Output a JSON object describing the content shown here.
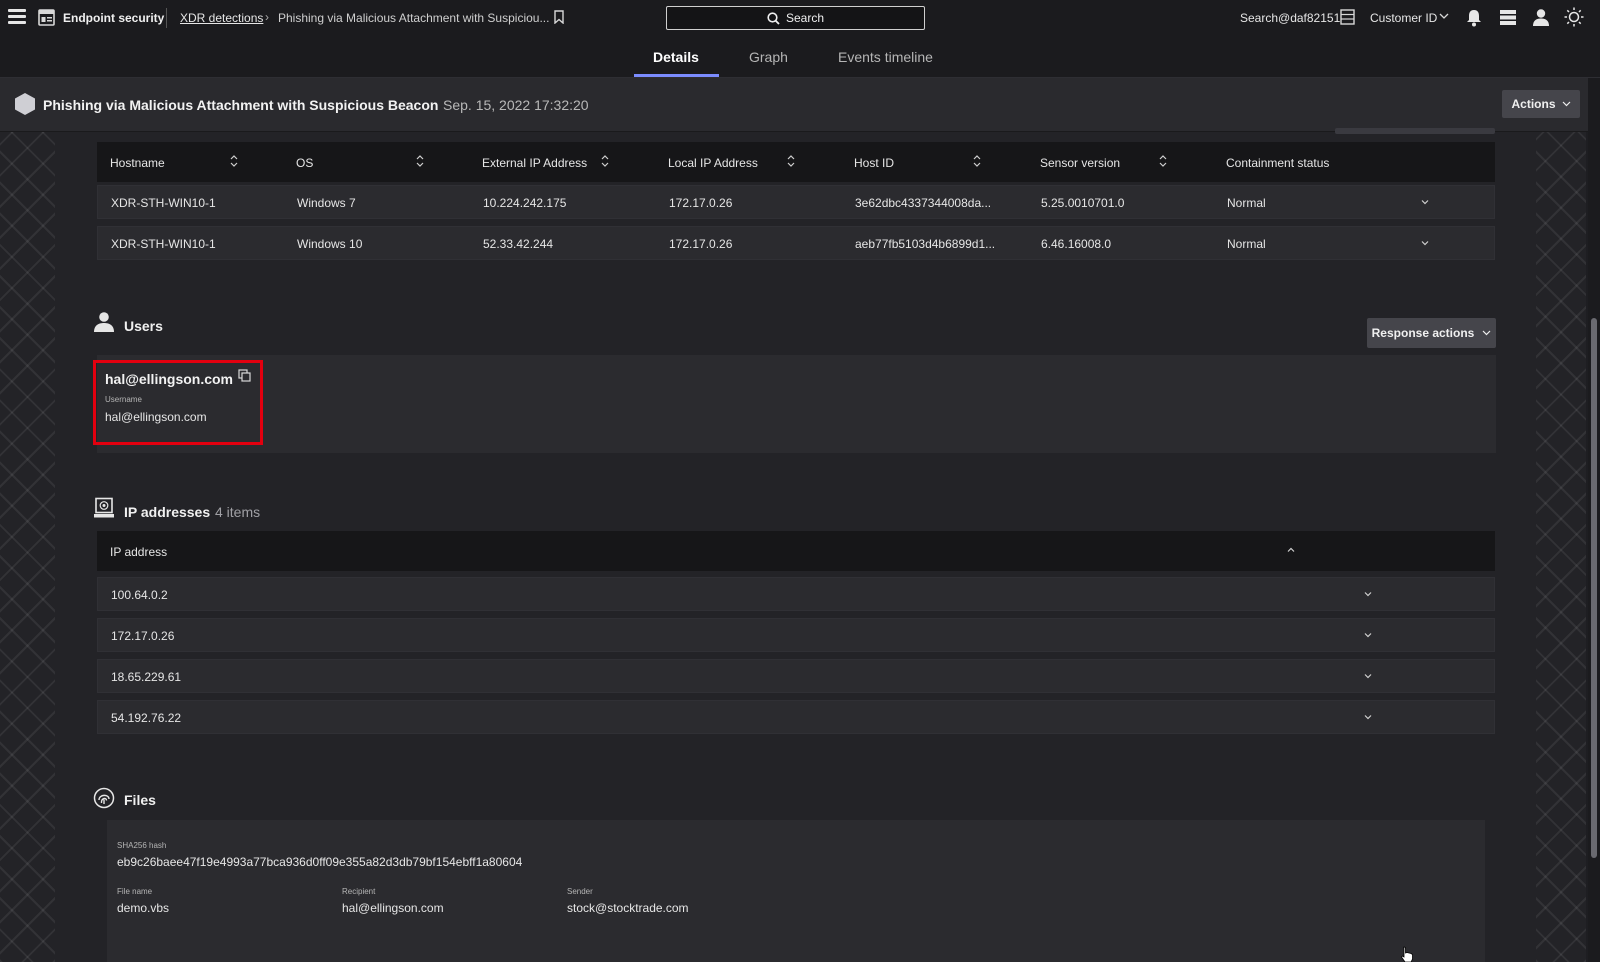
{
  "topbar": {
    "app_title": "Endpoint security",
    "breadcrumb_1": "XDR detections",
    "breadcrumb_2": "Phishing via Malicious Attachment with Suspiciou...",
    "search_label": "Search",
    "user_label": "Search@daf82151",
    "customer_id_label": "Customer ID"
  },
  "tabs": [
    {
      "label": "Details",
      "active": true
    },
    {
      "label": "Graph",
      "active": false
    },
    {
      "label": "Events timeline",
      "active": false
    }
  ],
  "detection": {
    "title": "Phishing via Malicious Attachment with Suspicious Beacon",
    "timestamp": "Sep. 15, 2022 17:32:20",
    "actions_label": "Actions"
  },
  "hosts": {
    "columns": [
      "Hostname",
      "OS",
      "External IP Address",
      "Local IP Address",
      "Host ID",
      "Sensor version",
      "Containment status"
    ],
    "rows": [
      [
        "XDR-STH-WIN10-1",
        "Windows 7",
        "10.224.242.175",
        "172.17.0.26",
        "3e62dbc4337344008da...",
        "5.25.0010701.0",
        "Normal"
      ],
      [
        "XDR-STH-WIN10-1",
        "Windows 10",
        "52.33.42.244",
        "172.17.0.26",
        "aeb77fb5103d4b6899d1...",
        "6.46.16008.0",
        "Normal"
      ]
    ]
  },
  "users": {
    "title": "Users",
    "response_actions_label": "Response actions",
    "user_name": "hal@ellingson.com",
    "username_label": "Username",
    "username_value": "hal@ellingson.com"
  },
  "ip_addresses": {
    "title": "IP addresses",
    "count_label": "4 items",
    "column": "IP address",
    "items": [
      "100.64.0.2",
      "172.17.0.26",
      "18.65.229.61",
      "54.192.76.22"
    ]
  },
  "files": {
    "title": "Files",
    "sha_label": "SHA256 hash",
    "sha_value": "eb9c26baee47f19e4993a77bca936d0ff09e355a82d3db79bf154ebff1a80604",
    "file_name_label": "File name",
    "file_name_value": "demo.vbs",
    "recipient_label": "Recipient",
    "recipient_value": "hal@ellingson.com",
    "sender_label": "Sender",
    "sender_value": "stock@stocktrade.com"
  },
  "colors": {
    "accent": "#7b8cff",
    "highlight": "#e3000f",
    "background": "#232327"
  }
}
